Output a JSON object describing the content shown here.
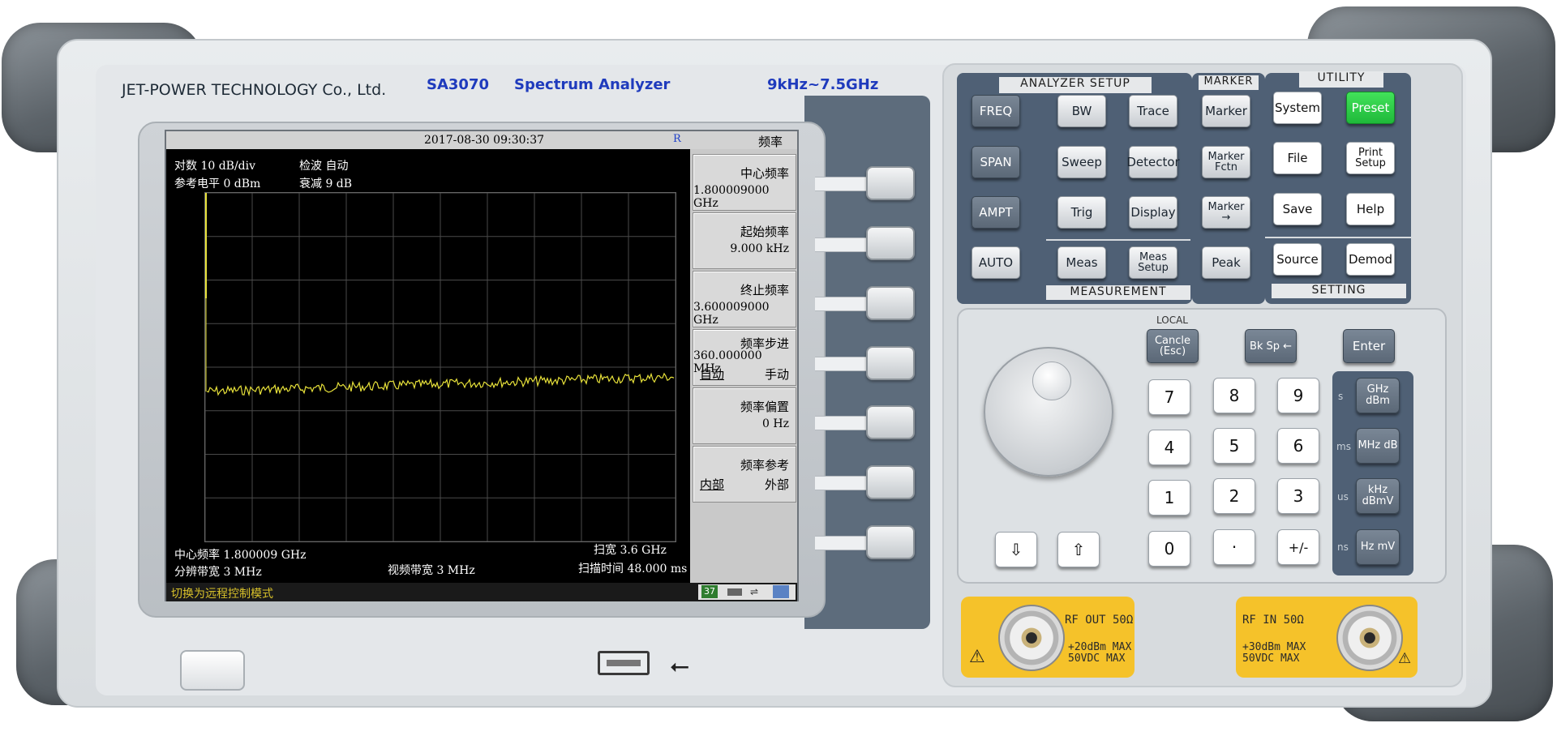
{
  "header": {
    "company": "JET-POWER TECHNOLOGY Co., Ltd.",
    "model": "SA3070",
    "product": "Spectrum Analyzer",
    "range": "9kHz~7.5GHz"
  },
  "screen": {
    "timestamp": "2017-08-30 09:30:37",
    "remote_flag": "R",
    "menu_title": "频率",
    "scale": "对数 10 dB/div",
    "detector": "检波 自动",
    "ref_level": "参考电平 0 dBm",
    "attenuation": "衰减 9 dB",
    "center_readout": "中心频率 1.800009 GHz",
    "span_readout": "扫宽 3.6 GHz",
    "rbw_readout": "分辨带宽 3 MHz",
    "vbw_readout": "视频带宽 3 MHz",
    "sweep_readout": "扫描时间 48.000 ms",
    "status_message": "切换为远程控制模式",
    "tray_number": "37",
    "softkeys": [
      {
        "title": "中心频率",
        "value": "1.800009000 GHz"
      },
      {
        "title": "起始频率",
        "value": "9.000 kHz"
      },
      {
        "title": "终止频率",
        "value": "3.600009000 GHz"
      },
      {
        "title": "频率步进",
        "value": "360.000000 MHz",
        "left": "自动",
        "right": "手动"
      },
      {
        "title": "频率偏置",
        "value": "0 Hz"
      },
      {
        "title": "频率参考",
        "left": "内部",
        "right": "外部"
      }
    ]
  },
  "panel": {
    "analyzer_setup_label": "ANALYZER SETUP",
    "marker_label": "MARKER",
    "utility_label": "UTILITY",
    "measurement_label": "MEASUREMENT",
    "setting_label": "SETTING",
    "local_label": "LOCAL",
    "keys": {
      "freq": "FREQ",
      "bw": "BW",
      "trace": "Trace",
      "span": "SPAN",
      "sweep": "Sweep",
      "detector": "Detector",
      "ampt": "AMPT",
      "trig": "Trig",
      "display": "Display",
      "auto": "AUTO",
      "meas": "Meas",
      "meas_setup": "Meas Setup",
      "marker": "Marker",
      "marker_fctn": "Marker Fctn",
      "marker_to": "Marker →",
      "peak": "Peak",
      "system": "System",
      "preset": "Preset",
      "file": "File",
      "print_setup": "Print Setup",
      "save": "Save",
      "help": "Help",
      "source": "Source",
      "demod": "Demod",
      "cancel": "Cancle (Esc)",
      "bksp": "Bk Sp ←",
      "enter": "Enter"
    },
    "numpad": [
      "7",
      "8",
      "9",
      "4",
      "5",
      "6",
      "1",
      "2",
      "3",
      "0",
      "·",
      "+/-"
    ],
    "units": [
      {
        "label": "GHz dBm",
        "side": "s"
      },
      {
        "label": "MHz dB",
        "side": "ms"
      },
      {
        "label": "kHz dBmV",
        "side": "us"
      },
      {
        "label": "Hz mV",
        "side": "ns"
      }
    ],
    "rf_out": {
      "title": "RF OUT 50Ω",
      "spec1": "+20dBm MAX",
      "spec2": "50VDC MAX"
    },
    "rf_in": {
      "title": "RF IN 50Ω",
      "spec1": "+30dBm MAX",
      "spec2": "50VDC MAX"
    }
  },
  "icons": [
    "power-button",
    "usb-port",
    "usb-icon",
    "arrow-down-icon",
    "arrow-up-icon",
    "warning-icon",
    "rotary-knob"
  ],
  "colors": {
    "trace": "#e8e23a",
    "preset": "#2ccb44",
    "panel_navy": "#4f6075",
    "port_yellow": "#f5c22a"
  }
}
